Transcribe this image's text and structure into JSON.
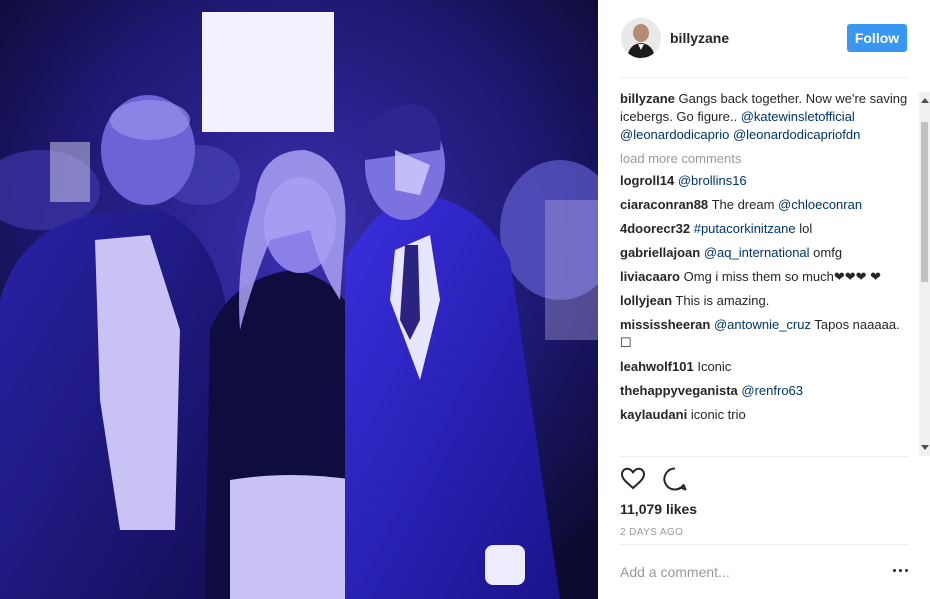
{
  "post": {
    "username": "billyzane",
    "follow_label": "Follow",
    "caption": {
      "username": "billyzane",
      "text": "Gangs back together. Now we're saving icebergs. Go figure..",
      "mentions": [
        "@katewinsletofficial",
        "@leonardodicaprio",
        "@leonardodicapriofdn"
      ]
    },
    "load_more": "load more comments",
    "comments": [
      {
        "user": "logroll14",
        "parts": [
          {
            "t": "@brollins16",
            "link": true
          }
        ]
      },
      {
        "user": "ciaraconran88",
        "parts": [
          {
            "t": "The dream ",
            "link": false
          },
          {
            "t": "@chloeconran",
            "link": true
          }
        ]
      },
      {
        "user": "4doorecr32",
        "parts": [
          {
            "t": "#putacorkinitzane",
            "link": true
          },
          {
            "t": " lol",
            "link": false
          }
        ]
      },
      {
        "user": "gabriellajoan",
        "parts": [
          {
            "t": "@aq_international",
            "link": true
          },
          {
            "t": " omfg",
            "link": false
          }
        ]
      },
      {
        "user": "liviacaaro",
        "parts": [
          {
            "t": "Omg i miss them so much❤❤❤ ❤",
            "link": false
          }
        ]
      },
      {
        "user": "lollyjean",
        "parts": [
          {
            "t": "This is amazing.",
            "link": false
          }
        ]
      },
      {
        "user": "mississheeran",
        "parts": [
          {
            "t": "@antownie_cruz",
            "link": true
          },
          {
            "t": " Tapos naaaaa. ☐",
            "link": false
          }
        ]
      },
      {
        "user": "leahwolf101",
        "parts": [
          {
            "t": "Iconic",
            "link": false
          }
        ]
      },
      {
        "user": "thehappyveganista",
        "parts": [
          {
            "t": "@renfro63",
            "link": true
          }
        ]
      },
      {
        "user": "kaylaudani",
        "parts": [
          {
            "t": "iconic trio",
            "link": false
          }
        ]
      }
    ],
    "likes": "11,079 likes",
    "time": "2 DAYS AGO",
    "comment_placeholder": "Add a comment...",
    "icons": {
      "like": "heart-icon",
      "comment": "comment-icon",
      "more": "ellipsis-icon"
    },
    "colors": {
      "follow_bg": "#3897f0",
      "link": "#003569",
      "muted": "#999999"
    }
  }
}
